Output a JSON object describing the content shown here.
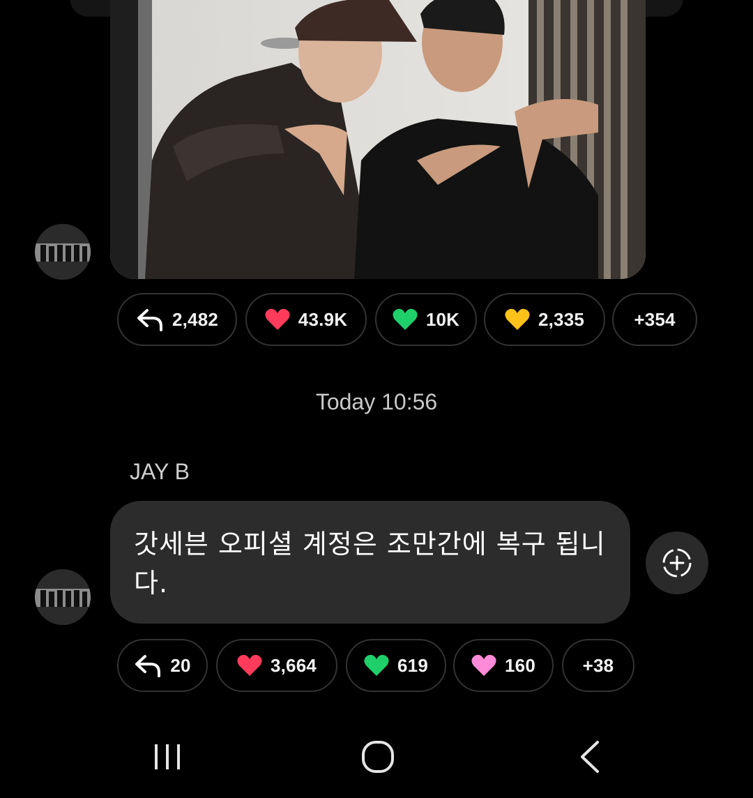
{
  "post1": {
    "reactions": {
      "reply": {
        "icon": "reply-arrow-icon",
        "count": "2,482"
      },
      "red": {
        "icon": "red-heart-icon",
        "count": "43.9K",
        "color": "#ff3b5c"
      },
      "green": {
        "icon": "green-heart-icon",
        "count": "10K",
        "color": "#1fcf6a"
      },
      "yellow": {
        "icon": "yellow-heart-icon",
        "count": "2,335",
        "color": "#ffc21a"
      },
      "more": "+354"
    }
  },
  "divider": {
    "timestamp": "Today 10:56"
  },
  "post2": {
    "sender": "JAY B",
    "text": "갓세븐 오피셜 계정은 조만간에 복구 됩니다.",
    "reactions": {
      "reply": {
        "icon": "reply-arrow-icon",
        "count": "20"
      },
      "red": {
        "icon": "red-heart-icon",
        "count": "3,664",
        "color": "#ff3b5c"
      },
      "green": {
        "icon": "green-heart-icon",
        "count": "619",
        "color": "#1fcf6a"
      },
      "pink": {
        "icon": "pink-heart-icon",
        "count": "160",
        "color": "#ff8ad8"
      },
      "more": "+38"
    }
  },
  "system_nav": {
    "recent": "recent-apps-icon",
    "home": "home-icon",
    "back": "back-icon"
  }
}
